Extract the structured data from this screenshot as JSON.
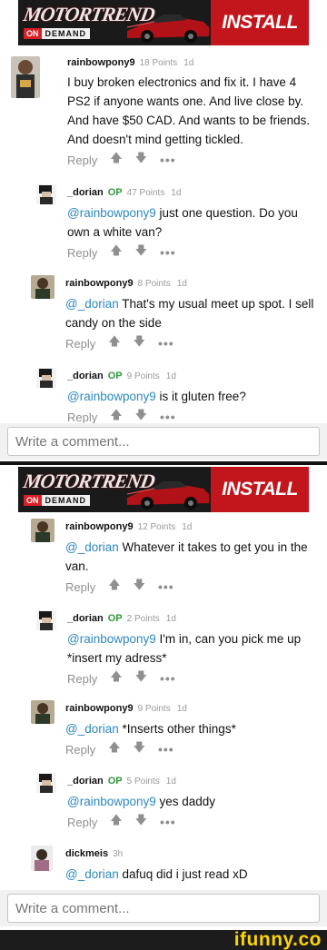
{
  "ad": {
    "brand": "MOTORTREND",
    "on": "ON",
    "demand": "DEMAND",
    "cta": "INSTALL NOW"
  },
  "top": {
    "comments": [
      {
        "author": "rainbowpony9",
        "op": "",
        "points": "18 Points",
        "time": "1d",
        "mention": "",
        "text": "I buy broken electronics and fix it. I have 4 PS2 if anyone wants one. And live close by. And have $50 CAD. And wants to be friends. And doesn't mind getting tickled."
      },
      {
        "author": "_dorian",
        "op": "OP",
        "points": "47 Points",
        "time": "1d",
        "mention": "@rainbowpony9",
        "text": " just one question. Do you own a white van?"
      },
      {
        "author": "rainbowpony9",
        "op": "",
        "points": "8 Points",
        "time": "1d",
        "mention": "@_dorian",
        "text": " That's my usual meet up spot. I sell candy on the side"
      },
      {
        "author": "_dorian",
        "op": "OP",
        "points": "9 Points",
        "time": "1d",
        "mention": "@rainbowpony9",
        "text": " is it gluten free?"
      }
    ]
  },
  "bottom": {
    "comments": [
      {
        "author": "rainbowpony9",
        "op": "",
        "points": "12 Points",
        "time": "1d",
        "mention": "@_dorian",
        "text": " Whatever it takes to get you in the van."
      },
      {
        "author": "_dorian",
        "op": "OP",
        "points": "2 Points",
        "time": "1d",
        "mention": "@rainbowpony9",
        "text": " I'm in, can you pick me up *insert my adress*"
      },
      {
        "author": "rainbowpony9",
        "op": "",
        "points": "9 Points",
        "time": "1d",
        "mention": "@_dorian",
        "text": " *Inserts other things*"
      },
      {
        "author": "_dorian",
        "op": "OP",
        "points": "5 Points",
        "time": "1d",
        "mention": "@rainbowpony9",
        "text": " yes daddy"
      },
      {
        "author": "dickmeis",
        "op": "",
        "points": "",
        "time": "3h",
        "mention": "@_dorian",
        "text": " dafuq did i just read xD"
      }
    ]
  },
  "actions": {
    "reply": "Reply",
    "up": "🡅",
    "down": "🡇",
    "more": "•••"
  },
  "write_placeholder": "Write a comment...",
  "footer": {
    "logo": "ifunny.co"
  },
  "colors": {
    "mention": "#2c88c0",
    "op": "#2f9a3a",
    "cta": "#c3161c",
    "logo": "#fdd400"
  }
}
